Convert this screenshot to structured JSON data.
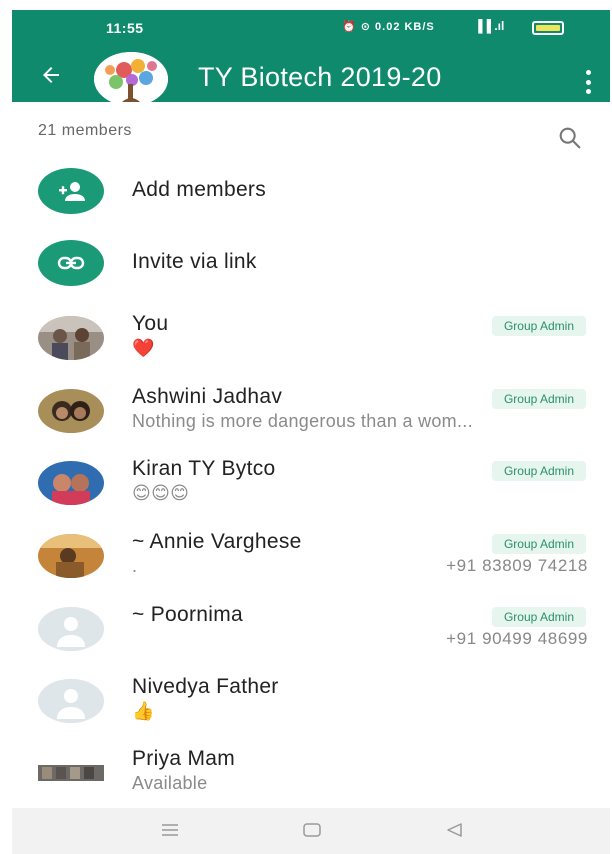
{
  "status_bar": {
    "time": "11:55",
    "icons": "⏰ ⊙ 0.02 KB/S",
    "signal": "▐▐ .ıl"
  },
  "header": {
    "title": "TY Biotech 2019-20",
    "back_icon": "arrow-left-icon",
    "menu_icon": "more-vert-icon"
  },
  "members_header": {
    "count_text": "21 members",
    "search_icon": "search-icon"
  },
  "actions": [
    {
      "label": "Add members",
      "icon": "add-group-icon"
    },
    {
      "label": "Invite via link",
      "icon": "link-icon"
    }
  ],
  "members": [
    {
      "name": "You",
      "status": "❤️",
      "badge": "Group Admin",
      "phone": ""
    },
    {
      "name": "Ashwini Jadhav",
      "status": "Nothing is more dangerous than a wom...",
      "badge": "Group Admin",
      "phone": ""
    },
    {
      "name": "Kiran TY Bytco",
      "status": "😊😊😊",
      "badge": "Group Admin",
      "phone": ""
    },
    {
      "name": "~ Annie Varghese",
      "status": ".",
      "badge": "Group Admin",
      "phone": "+91 83809 74218"
    },
    {
      "name": "~ Poornima",
      "status": "",
      "badge": "Group Admin",
      "phone": "+91 90499 48699"
    },
    {
      "name": "Nivedya Father",
      "status": "👍",
      "badge": "",
      "phone": ""
    },
    {
      "name": "Priya Mam",
      "status": "Available",
      "badge": "",
      "phone": ""
    }
  ],
  "colors": {
    "primary": "#0f8a6d",
    "accent": "#1a9a76",
    "badge_text": "#2a8f6f",
    "badge_bg": "#e6f6ee"
  },
  "nav": {
    "menu_icon": "recent-apps-icon",
    "home_icon": "home-icon",
    "back_icon": "back-triangle-icon"
  }
}
